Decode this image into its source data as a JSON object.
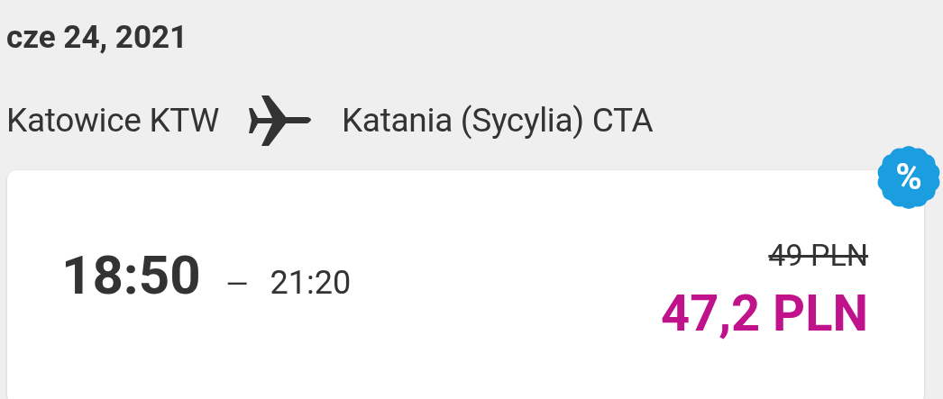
{
  "date": "cze 24, 2021",
  "route": {
    "origin": "Katowice KTW",
    "destination": "Katania (Sycylia) CTA"
  },
  "flight": {
    "badge": "%",
    "departure": "18:50",
    "separator": "—",
    "arrival": "21:20",
    "old_price": "49 PLN",
    "price": "47,2 PLN"
  }
}
